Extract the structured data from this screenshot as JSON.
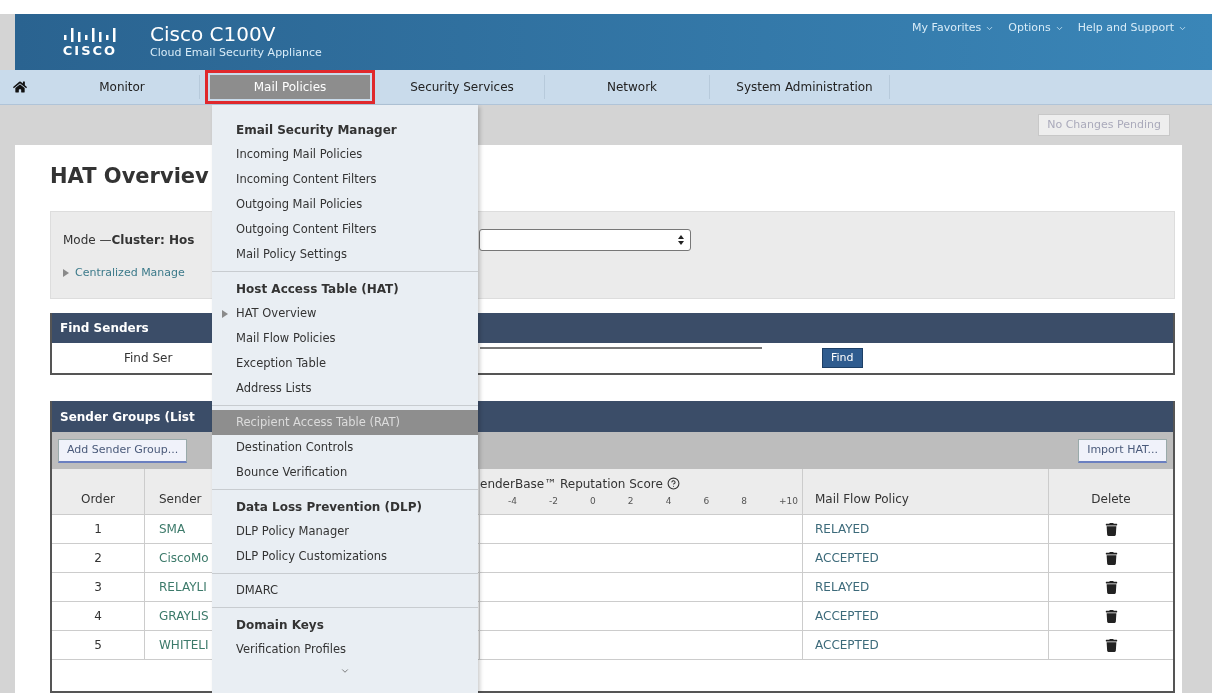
{
  "header": {
    "logo_text": "CISCO",
    "product": "Cisco C100V",
    "subtitle": "Cloud Email Security Appliance",
    "links": [
      "My Favorites",
      "Options",
      "Help and Support"
    ]
  },
  "nav": {
    "tabs": [
      {
        "label": "Monitor",
        "selected": false,
        "outlined": false
      },
      {
        "label": "Mail Policies",
        "selected": true,
        "outlined": true
      },
      {
        "label": "Security Services",
        "selected": false,
        "outlined": false
      },
      {
        "label": "Network",
        "selected": false,
        "outlined": false
      },
      {
        "label": "System Administration",
        "selected": false,
        "outlined": false
      }
    ]
  },
  "changes_button": {
    "label": "No Changes Pending",
    "disabled": true
  },
  "page": {
    "title": "HAT Overviev",
    "mode": "Mode —**Cluster: Hos**",
    "centralized": "Centralized Manage",
    "find_senders": {
      "title": "Find Senders",
      "label": "Find Ser",
      "button": "Find"
    },
    "sender_groups": {
      "title": "Sender Groups (List",
      "add_button": "Add Sender Group...",
      "import_button": "Import HAT...",
      "columns": [
        "Order",
        "Sender",
        "enderBase™ Reputation Score",
        "Mail Flow Policy",
        "Delete"
      ],
      "ticks": [
        "-4",
        "-2",
        "0",
        "2",
        "4",
        "6",
        "8",
        "+10"
      ],
      "rows": [
        {
          "order": "1",
          "group": "SMA",
          "policy": "RELAYED"
        },
        {
          "order": "2",
          "group": "CiscoMo",
          "policy": "ACCEPTED"
        },
        {
          "order": "3",
          "group": "RELAYLI",
          "policy": "RELAYED"
        },
        {
          "order": "4",
          "group": "GRAYLIS",
          "policy": "ACCEPTED"
        },
        {
          "order": "5",
          "group": "WHITELI",
          "policy": "ACCEPTED"
        }
      ]
    }
  },
  "menu": {
    "sections": [
      {
        "heading": "Email Security Manager",
        "items": [
          {
            "label": "Incoming Mail Policies",
            "current": false,
            "highlighted": false
          },
          {
            "label": "Incoming Content Filters",
            "current": false,
            "highlighted": false
          },
          {
            "label": "Outgoing Mail Policies",
            "current": false,
            "highlighted": false
          },
          {
            "label": "Outgoing Content Filters",
            "current": false,
            "highlighted": false
          },
          {
            "label": "Mail Policy Settings",
            "current": false,
            "highlighted": false
          }
        ]
      },
      {
        "heading": "Host Access Table (HAT)",
        "items": [
          {
            "label": "HAT Overview",
            "current": true,
            "highlighted": false
          },
          {
            "label": "Mail Flow Policies",
            "current": false,
            "highlighted": false
          },
          {
            "label": "Exception Table",
            "current": false,
            "highlighted": false
          },
          {
            "label": "Address Lists",
            "current": false,
            "highlighted": false
          }
        ]
      },
      {
        "items": [
          {
            "label": "Recipient Access Table (RAT)",
            "current": false,
            "highlighted": true
          },
          {
            "label": "Destination Controls",
            "current": false,
            "highlighted": false
          },
          {
            "label": "Bounce Verification",
            "current": false,
            "highlighted": false
          }
        ]
      },
      {
        "heading": "Data Loss Prevention (DLP)",
        "items": [
          {
            "label": "DLP Policy Manager",
            "current": false,
            "highlighted": false
          },
          {
            "label": "DLP Policy Customizations",
            "current": false,
            "highlighted": false
          }
        ]
      },
      {
        "items": [
          {
            "label": "DMARC",
            "current": false,
            "highlighted": false
          }
        ]
      },
      {
        "heading": "Domain Keys",
        "items": [
          {
            "label": "Verification Profiles",
            "current": false,
            "highlighted": false
          }
        ]
      }
    ]
  }
}
